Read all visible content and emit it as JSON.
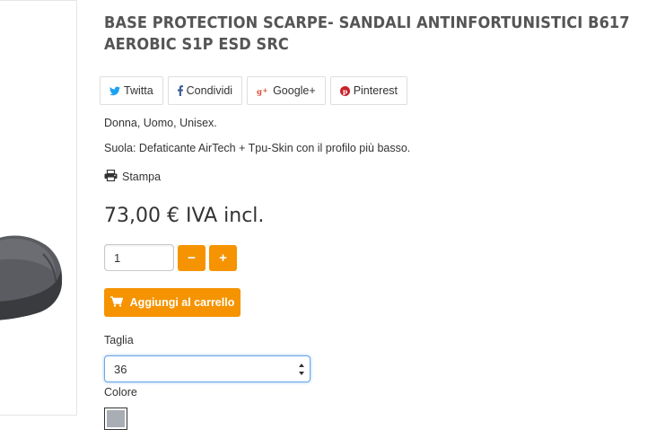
{
  "product": {
    "title": "BASE PROTECTION SCARPE- SANDALI ANTINFORTUNISTICI B617 AEROBIC S1P ESD SRC",
    "image_icon": "shoe-product-image"
  },
  "social": {
    "twitter_label": "Twitta",
    "facebook_label": "Condividi",
    "googleplus_label": "Google+",
    "pinterest_label": "Pinterest",
    "twitter_color": "#1da1f2",
    "facebook_color": "#3b5998",
    "googleplus_color": "#dd4b39",
    "pinterest_color": "#cb2027"
  },
  "description": {
    "line1": "Donna, Uomo, Unisex.",
    "line2": "Suola: Defaticante AirTech + Tpu-Skin con il profilo più basso."
  },
  "print_label": "Stampa",
  "price": "73,00 € IVA incl.",
  "quantity": {
    "value": "1",
    "minus_label": "−",
    "plus_label": "+"
  },
  "cart": {
    "add_label": "Aggiungi al carrello"
  },
  "options": {
    "size_label": "Taglia",
    "size_value": "36",
    "color_label": "Colore",
    "color_swatch": "#a9adb4"
  },
  "colors": {
    "accent": "#f59300"
  }
}
